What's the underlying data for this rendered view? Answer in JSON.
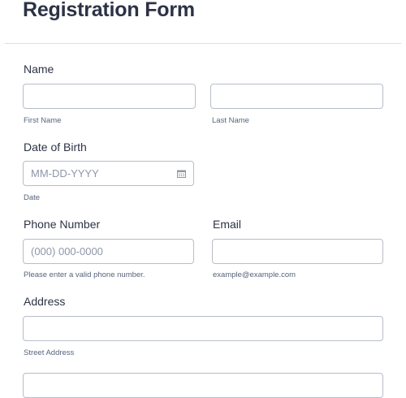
{
  "form": {
    "title": "Registration Form"
  },
  "name": {
    "label": "Name",
    "first_sublabel": "First Name",
    "last_sublabel": "Last Name",
    "first_value": "",
    "last_value": ""
  },
  "dob": {
    "label": "Date of Birth",
    "placeholder": "MM-DD-YYYY",
    "sublabel": "Date",
    "icon": "calendar-icon"
  },
  "phone": {
    "label": "Phone Number",
    "placeholder": "(000) 000-0000",
    "sublabel": "Please enter a valid phone number."
  },
  "email": {
    "label": "Email",
    "value": "",
    "sublabel": "example@example.com"
  },
  "address": {
    "label": "Address",
    "street_sublabel": "Street Address",
    "street_value": "",
    "line2_value": ""
  },
  "colors": {
    "text": "#2c3345",
    "border": "#b8bdc9",
    "placeholder": "#8f96a8",
    "sublabel": "#57647e"
  }
}
